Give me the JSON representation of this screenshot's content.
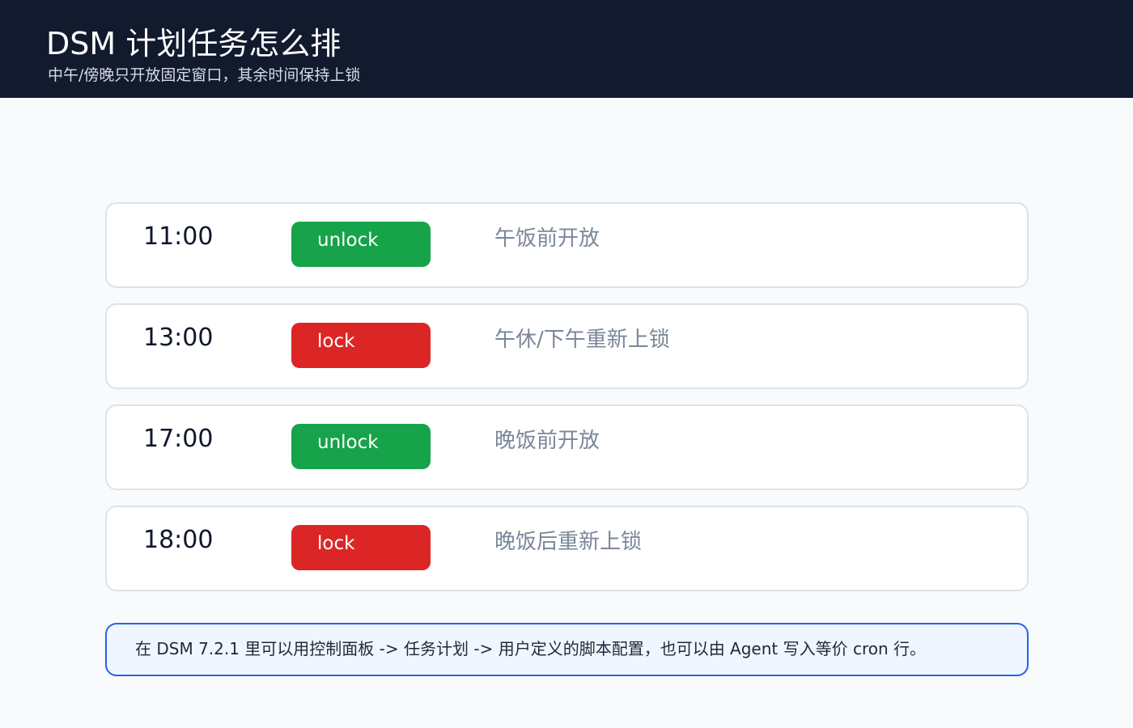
{
  "header": {
    "title": "DSM 计划任务怎么排",
    "subtitle": "中午/傍晚只开放固定窗口，其余时间保持上锁"
  },
  "schedule": [
    {
      "time": "11:00",
      "action": "unlock",
      "note": "午饭前开放"
    },
    {
      "time": "13:00",
      "action": "lock",
      "note": "午休/下午重新上锁"
    },
    {
      "time": "17:00",
      "action": "unlock",
      "note": "晚饭前开放"
    },
    {
      "time": "18:00",
      "action": "lock",
      "note": "晚饭后重新上锁"
    }
  ],
  "footer": {
    "note": "在 DSM 7.2.1 里可以用控制面板 -> 任务计划 -> 用户定义的脚本配置，也可以由 Agent 写入等价 cron 行。"
  },
  "colors": {
    "header_bg": "#121a2e",
    "unlock": "#16a34a",
    "lock": "#dc2626",
    "note_border": "#2563eb",
    "note_bg": "#eff6ff"
  }
}
